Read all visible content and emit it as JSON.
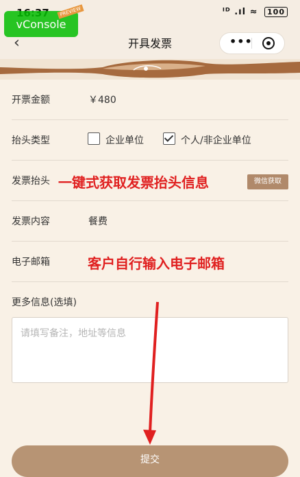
{
  "status": {
    "time": "16:37",
    "signal": "ᴵᴰ .ıl ≈",
    "battery": "100"
  },
  "vconsole": {
    "label": "vConsole",
    "tag": "PREVIEW"
  },
  "nav": {
    "title": "开具发票",
    "back": "‹",
    "more": "•••"
  },
  "form": {
    "amount": {
      "label": "开票金额",
      "value": "￥480"
    },
    "header_type": {
      "label": "抬头类型",
      "options": [
        {
          "label": "企业单位",
          "checked": false
        },
        {
          "label": "个人/非企业单位",
          "checked": true
        }
      ]
    },
    "invoice_title": {
      "label": "发票抬头",
      "annotation": "一键式获取发票抬头信息",
      "button": "微信获取"
    },
    "content": {
      "label": "发票内容",
      "value": "餐费"
    },
    "email": {
      "label": "电子邮箱",
      "annotation": "客户自行输入电子邮箱"
    },
    "more": {
      "label": "更多信息(选填)",
      "placeholder": "请填写备注，地址等信息"
    },
    "submit": "提交"
  },
  "colors": {
    "accent": "#b79474",
    "annotation": "#e02020",
    "background": "#f9f1e6"
  }
}
